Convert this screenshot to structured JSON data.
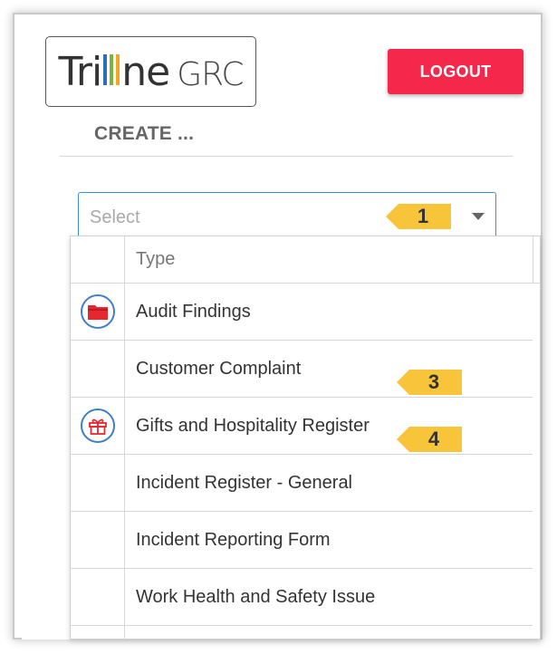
{
  "logo": {
    "word_start": "Tri",
    "word_end": "ne",
    "suffix": "GRC"
  },
  "header": {
    "logout_label": "LOGOUT"
  },
  "create": {
    "title": "CREATE ..."
  },
  "select": {
    "placeholder": "Select"
  },
  "callouts": [
    {
      "number": "1"
    },
    {
      "number": "3"
    },
    {
      "number": "4"
    }
  ],
  "table": {
    "header": "Type",
    "rows": [
      {
        "label": "Audit Findings",
        "icon": "folder-icon"
      },
      {
        "label": "Customer Complaint",
        "icon": ""
      },
      {
        "label": "Gifts and Hospitality Register",
        "icon": "gift-icon"
      },
      {
        "label": "Incident Register - General",
        "icon": ""
      },
      {
        "label": "Incident Reporting Form",
        "icon": ""
      },
      {
        "label": "Work Health and Safety Issue",
        "icon": ""
      }
    ]
  },
  "colors": {
    "logout": "#f5274a",
    "select_border": "#3f8fd6",
    "callout": "#f7c43a",
    "icon_red": "#e8262f",
    "icon_ring": "#3f7fc9"
  }
}
